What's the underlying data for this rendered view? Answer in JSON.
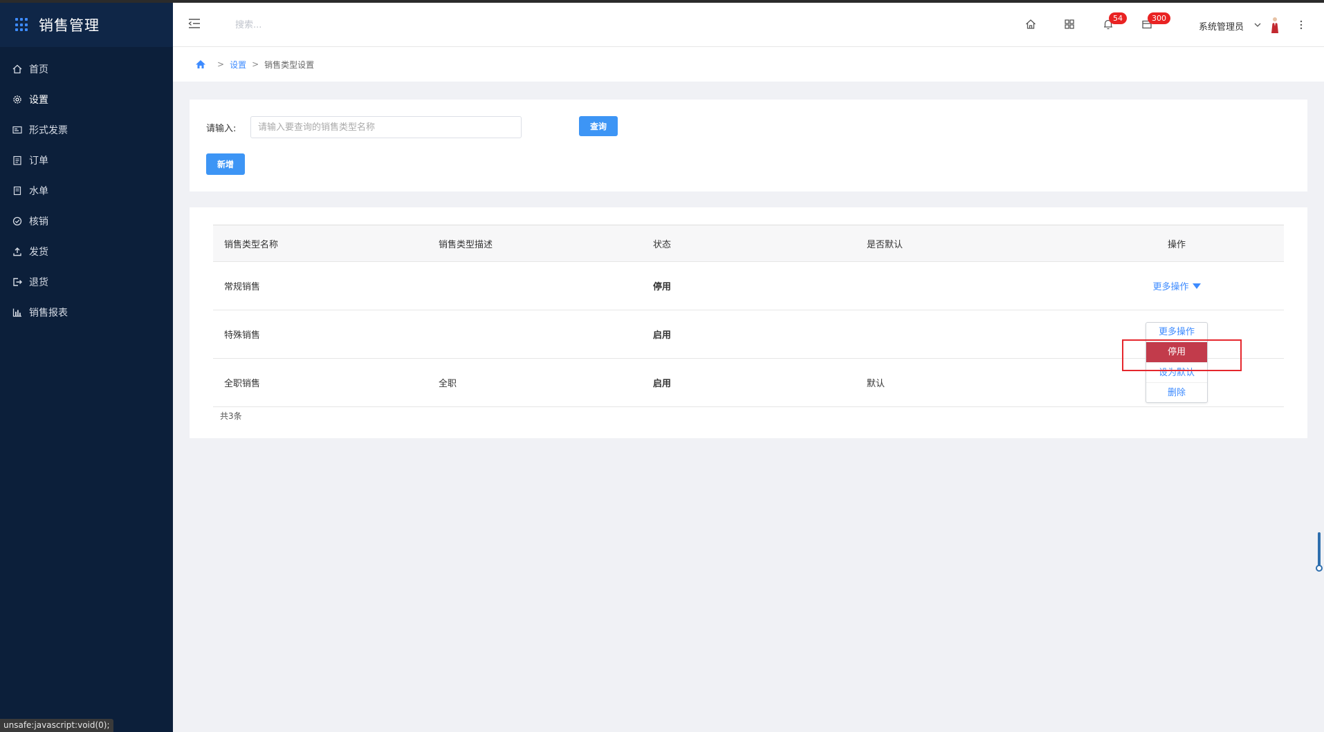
{
  "app": {
    "title": "销售管理"
  },
  "sidebar": {
    "items": [
      {
        "label": "首页",
        "icon": "home-icon"
      },
      {
        "label": "设置",
        "icon": "gear-icon"
      },
      {
        "label": "形式发票",
        "icon": "invoice-icon"
      },
      {
        "label": "订单",
        "icon": "clipboard-icon"
      },
      {
        "label": "水单",
        "icon": "receipt-icon"
      },
      {
        "label": "核销",
        "icon": "check-circle-icon"
      },
      {
        "label": "发货",
        "icon": "upload-icon"
      },
      {
        "label": "退货",
        "icon": "return-icon"
      },
      {
        "label": "销售报表",
        "icon": "bar-chart-icon"
      }
    ],
    "active": "设置"
  },
  "header": {
    "search_placeholder": "搜索...",
    "notifications_count": "54",
    "messages_count": "300",
    "user_name": "系统管理员"
  },
  "breadcrumb": {
    "items": [
      "设置",
      "销售类型设置"
    ],
    "separator": ">"
  },
  "query": {
    "label": "请输入:",
    "placeholder": "请输入要查询的销售类型名称",
    "value": "",
    "search_button": "查询",
    "add_button": "新增"
  },
  "table": {
    "headers": [
      "销售类型名称",
      "销售类型描述",
      "状态",
      "是否默认",
      "操作"
    ],
    "rows": [
      {
        "name": "常规销售",
        "desc": "",
        "status": "停用",
        "default": "",
        "action": "更多操作"
      },
      {
        "name": "特殊销售",
        "desc": "",
        "status": "启用",
        "default": "",
        "action": "更多操作"
      },
      {
        "name": "全职销售",
        "desc": "全职",
        "status": "启用",
        "default": "默认",
        "action": ""
      }
    ],
    "total": "共3条"
  },
  "dropdown": {
    "title": "更多操作",
    "items": [
      "停用",
      "设为默认",
      "删除"
    ]
  },
  "status_bar": {
    "text": "unsafe:javascript:void(0);"
  },
  "colors": {
    "sidebar": "#0c1f3a",
    "primary": "#3d95f5",
    "danger": "#e51c23",
    "success": "#3fb24d",
    "highlight": "#c23b4b"
  }
}
